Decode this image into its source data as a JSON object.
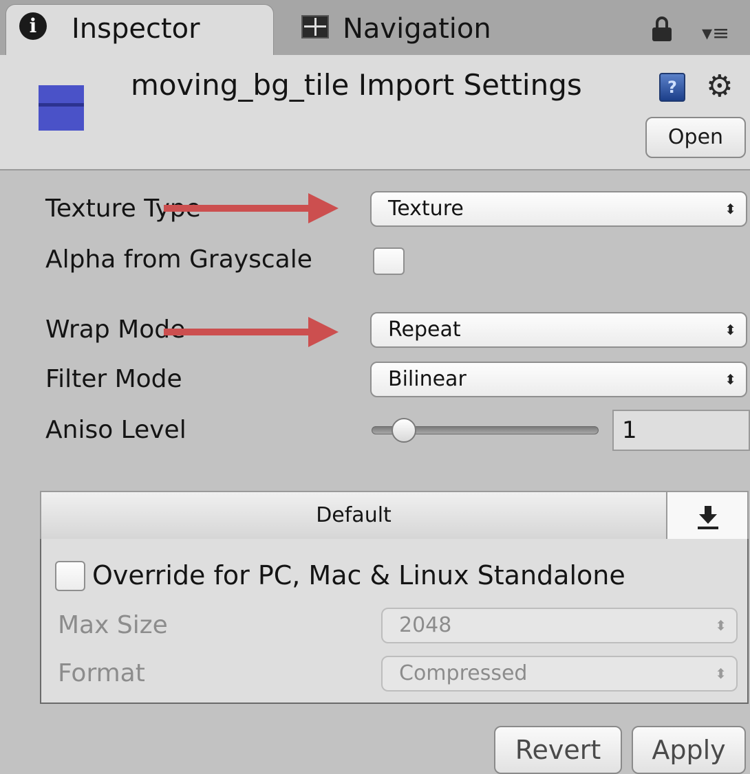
{
  "tabs": {
    "inspector": {
      "label": "Inspector",
      "icon": "info-icon"
    },
    "navigation": {
      "label": "Navigation",
      "icon": "navmesh-icon"
    }
  },
  "header": {
    "title": "moving_bg_tile Import Settings",
    "thumbnail_color": "#4a52c8",
    "open_label": "Open"
  },
  "form": {
    "texture_type": {
      "label": "Texture Type",
      "value": "Texture"
    },
    "alpha_from_grayscale": {
      "label": "Alpha from Grayscale",
      "checked": false
    },
    "wrap_mode": {
      "label": "Wrap Mode",
      "value": "Repeat"
    },
    "filter_mode": {
      "label": "Filter Mode",
      "value": "Bilinear"
    },
    "aniso_level": {
      "label": "Aniso Level",
      "value": "1",
      "slider_fraction": 0.1
    }
  },
  "platform": {
    "tab_label": "Default",
    "override_label": "Override for PC, Mac & Linux Standalone",
    "override_checked": false,
    "max_size": {
      "label": "Max Size",
      "value": "2048"
    },
    "format": {
      "label": "Format",
      "value": "Compressed"
    }
  },
  "footer": {
    "revert_label": "Revert",
    "apply_label": "Apply"
  },
  "annotation_color": "#cc4f4f",
  "select_arrows_glyph": "⬍"
}
